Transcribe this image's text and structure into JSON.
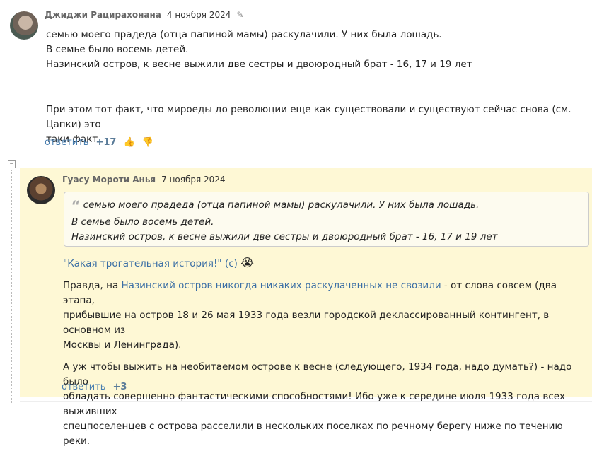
{
  "comment": {
    "author": "Джиджи Рацирахонана",
    "date": "4 ноября 2024",
    "lines": [
      "семью моего прадеда (отца папиной мамы) раскулачили. У них была лошадь.",
      "В семье было восемь детей.",
      "Назинский остров, к весне выжили две сестры и двоюродный брат - 16, 17 и 19 лет"
    ],
    "lines2": [
      "При этом тот факт, что мироеды до революции еще как существовали и существуют сейчас снова (см. Цапки) это",
      "таки факт"
    ],
    "reply_label": "ответить",
    "score": "+17"
  },
  "collapse_label": "−",
  "reply": {
    "author": "Гуасу Мороти Анья",
    "date": "7 ноября 2024",
    "quote_lines": [
      "семью моего прадеда (отца папиной мамы) раскулачили. У них была лошадь.",
      "В семье было восемь детей.",
      "Назинский остров, к весне выжили две сестры и двоюродный брат - 16, 17 и 19 лет"
    ],
    "quote_phrase": "\"Какая трогательная история!\"",
    "quote_phrase_suffix": " (с) ",
    "emoji": "😭",
    "p2_prefix": "Правда, на ",
    "p2_link": "Назинский остров никогда никаких раскулаченных не свозили",
    "p2_line1_rest": " - от слова совсем (два этапа,",
    "p2_line2": "прибывшие на остров 18 и 26 мая 1933 года везли городской деклассированный контингент, в основном из",
    "p2_line3": "Москвы и Ленинграда).",
    "p3_lines": [
      "А уж чтобы выжить на необитаемом острове к весне (следующего, 1934 года, надо думать?) - надо было",
      "обладать совершенно фантастическими способностями!  Ибо уже к середине июля 1933 года всех выживших",
      "спецпоселенцев с острова расселили в нескольких поселках по речному берегу ниже по течению реки."
    ],
    "reply_label": "ответить",
    "score": "+3"
  }
}
